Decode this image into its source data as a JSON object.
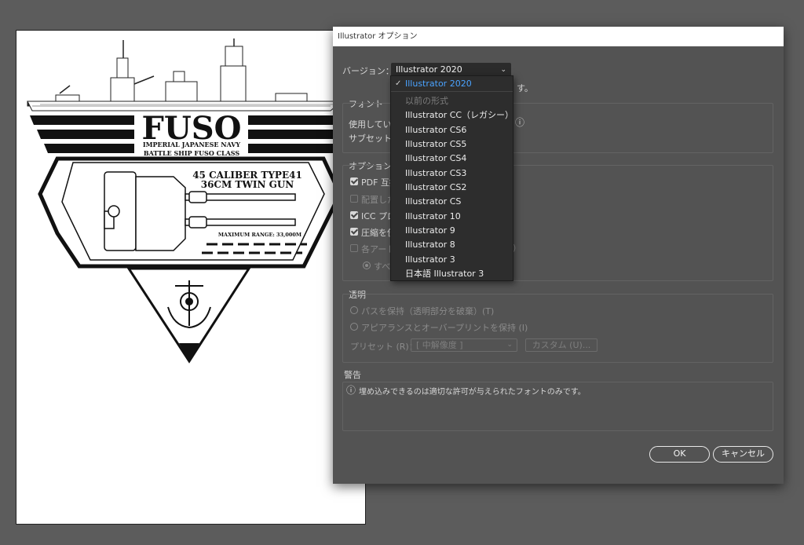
{
  "dialog": {
    "title": "Illustrator オプション",
    "version_label": "バージョン：",
    "version_value": "Illustrator 2020",
    "version_note_suffix": "す。",
    "font_section": "フォント",
    "font_line1": "使用してい",
    "font_line2": "サブセット(",
    "options_section": "オプション",
    "opt_pdf": "PDF 互換",
    "opt_placed": "配置した",
    "opt_icc": "ICC プロ",
    "opt_compress": "圧縮を使",
    "opt_artboards": "各アート",
    "opt_all": "すべ",
    "opt_artboards_suffix": ")",
    "transparency_section": "透明",
    "trans_keep_paths": "パスを保持（透明部分を破棄）(T)",
    "trans_keep_appearance": "アピアランスとオーバープリントを保持 (I)",
    "preset_label": "プリセット (R)：",
    "preset_value": "[ 中解像度 ]",
    "custom_button": "カスタム (U)...",
    "warning_section": "警告",
    "warning_text": "埋め込みできるのは適切な許可が与えられたフォントのみです。",
    "ok_button": "OK",
    "cancel_button": "キャンセル"
  },
  "dropdown": {
    "selected": "Illustrator 2020",
    "legacy_header": "以前の形式",
    "items": [
      "Illustrator CC（レガシー）",
      "Illustrator CS6",
      "Illustrator CS5",
      "Illustrator CS4",
      "Illustrator CS3",
      "Illustrator CS2",
      "Illustrator CS",
      "Illustrator 10",
      "Illustrator 9",
      "Illustrator 8",
      "Illustrator 3",
      "日本語 Illustrator 3"
    ]
  },
  "artwork": {
    "name": "FUSO",
    "line1": "IMPERIAL JAPANESE NAVY",
    "line2": "BATTLE SHIP FUSO CLASS",
    "gun_line1": "45 CALIBER TYPE41",
    "gun_line2": "36CM TWIN GUN",
    "range": "MAXIMUM RANGE: 33,000M"
  },
  "colors": {
    "background": "#5c5c5c",
    "dialog": "#535353",
    "selected_item": "#4aa3ff",
    "dropdown": "#2d2d2d"
  }
}
